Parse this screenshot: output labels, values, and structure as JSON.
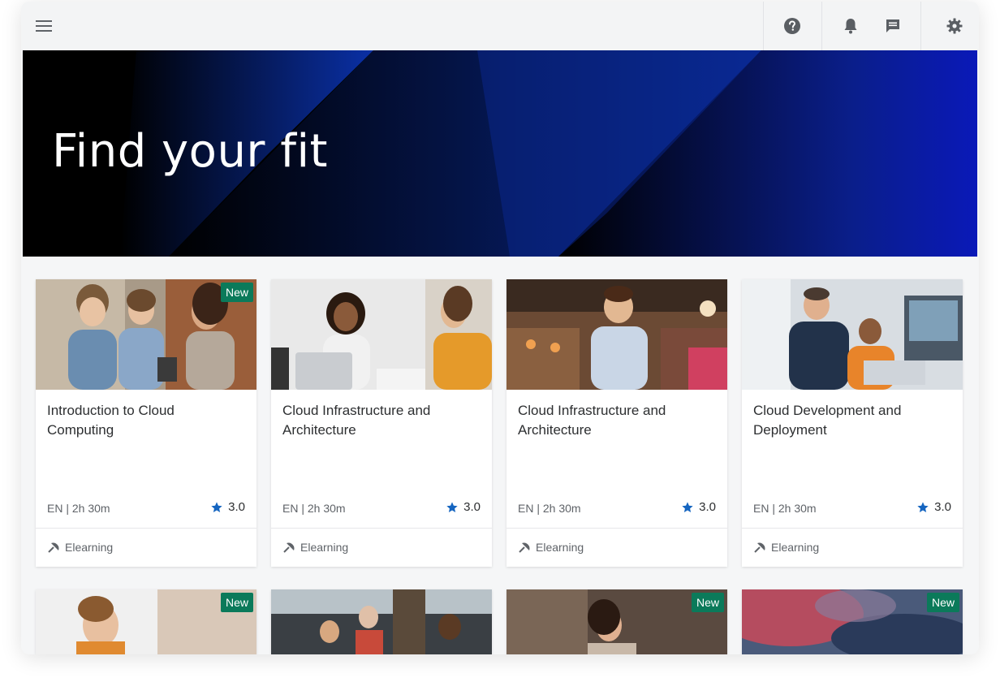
{
  "topbar": {
    "menu_icon": "hamburger-menu-icon",
    "help_icon": "help-circle-icon",
    "notifications_icon": "bell-icon",
    "messages_icon": "chat-message-icon",
    "settings_icon": "gear-icon"
  },
  "hero": {
    "title": "Find your fit"
  },
  "colors": {
    "badge_green": "#0b7a5a",
    "star_blue": "#1565c0",
    "hero_blue": "#0a3cff"
  },
  "cards": [
    {
      "title": "Introduction to Cloud Computing",
      "meta": "EN | 2h 30m",
      "rating": "3.0",
      "type": "Elearning",
      "badge": "New"
    },
    {
      "title": "Cloud Infrastructure and Architecture",
      "meta": "EN | 2h 30m",
      "rating": "3.0",
      "type": "Elearning",
      "badge": ""
    },
    {
      "title": "Cloud Infrastructure and Architecture",
      "meta": "EN | 2h 30m",
      "rating": "3.0",
      "type": "Elearning",
      "badge": ""
    },
    {
      "title": "Cloud Development and Deployment",
      "meta": "EN | 2h 30m",
      "rating": "3.0",
      "type": "Elearning",
      "badge": ""
    }
  ],
  "cards_row2": [
    {
      "badge": "New"
    },
    {
      "badge": ""
    },
    {
      "badge": "New"
    },
    {
      "badge": "New"
    }
  ]
}
